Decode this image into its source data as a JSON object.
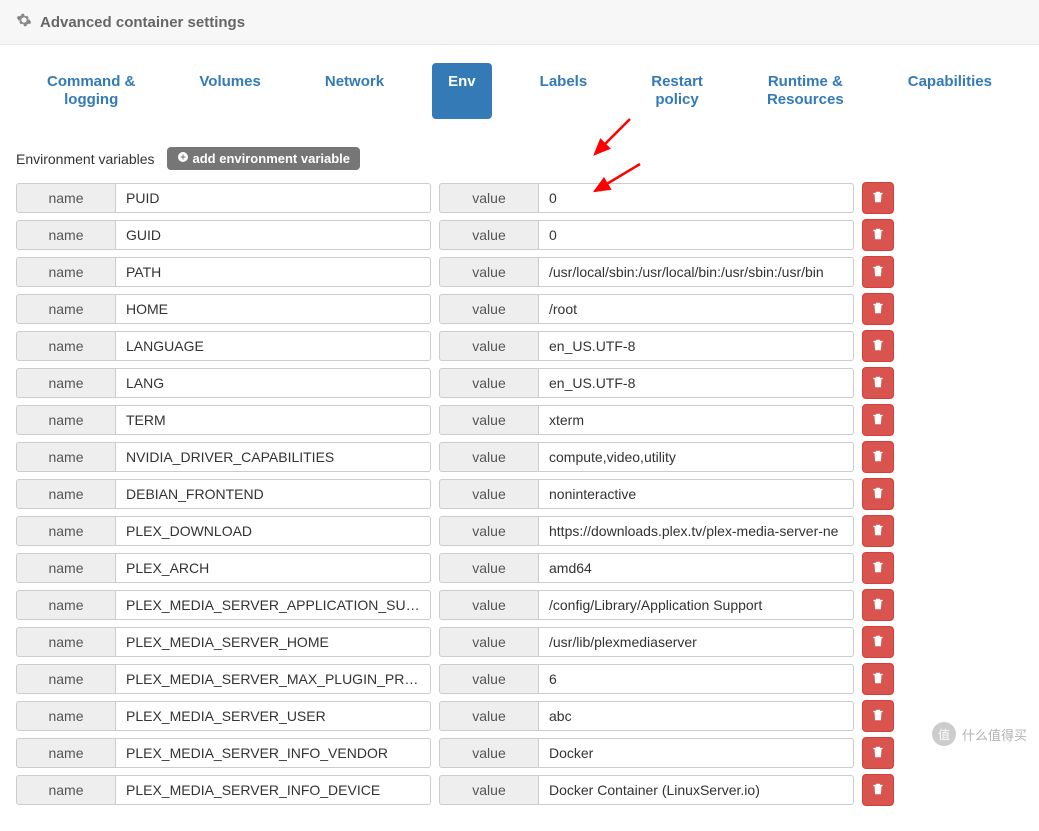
{
  "header": {
    "title": "Advanced container settings"
  },
  "tabs": [
    {
      "label": "Command &\nlogging",
      "active": false
    },
    {
      "label": "Volumes",
      "active": false
    },
    {
      "label": "Network",
      "active": false
    },
    {
      "label": "Env",
      "active": true
    },
    {
      "label": "Labels",
      "active": false
    },
    {
      "label": "Restart\npolicy",
      "active": false
    },
    {
      "label": "Runtime &\nResources",
      "active": false
    },
    {
      "label": "Capabilities",
      "active": false
    }
  ],
  "section": {
    "title": "Environment variables",
    "add_label": "add environment variable",
    "name_label": "name",
    "value_label": "value"
  },
  "env_vars": [
    {
      "name": "PUID",
      "value": "0"
    },
    {
      "name": "GUID",
      "value": "0"
    },
    {
      "name": "PATH",
      "value": "/usr/local/sbin:/usr/local/bin:/usr/sbin:/usr/bin"
    },
    {
      "name": "HOME",
      "value": "/root"
    },
    {
      "name": "LANGUAGE",
      "value": "en_US.UTF-8"
    },
    {
      "name": "LANG",
      "value": "en_US.UTF-8"
    },
    {
      "name": "TERM",
      "value": "xterm"
    },
    {
      "name": "NVIDIA_DRIVER_CAPABILITIES",
      "value": "compute,video,utility"
    },
    {
      "name": "DEBIAN_FRONTEND",
      "value": "noninteractive"
    },
    {
      "name": "PLEX_DOWNLOAD",
      "value": "https://downloads.plex.tv/plex-media-server-ne"
    },
    {
      "name": "PLEX_ARCH",
      "value": "amd64"
    },
    {
      "name": "PLEX_MEDIA_SERVER_APPLICATION_SUPPOR",
      "value": "/config/Library/Application Support"
    },
    {
      "name": "PLEX_MEDIA_SERVER_HOME",
      "value": "/usr/lib/plexmediaserver"
    },
    {
      "name": "PLEX_MEDIA_SERVER_MAX_PLUGIN_PROCS",
      "value": "6"
    },
    {
      "name": "PLEX_MEDIA_SERVER_USER",
      "value": "abc"
    },
    {
      "name": "PLEX_MEDIA_SERVER_INFO_VENDOR",
      "value": "Docker"
    },
    {
      "name": "PLEX_MEDIA_SERVER_INFO_DEVICE",
      "value": "Docker Container (LinuxServer.io)"
    }
  ],
  "watermark": {
    "text": "什么值得买",
    "badge": "值"
  },
  "colors": {
    "accent": "#337ab7",
    "danger": "#d9534f",
    "add": "#767676"
  }
}
